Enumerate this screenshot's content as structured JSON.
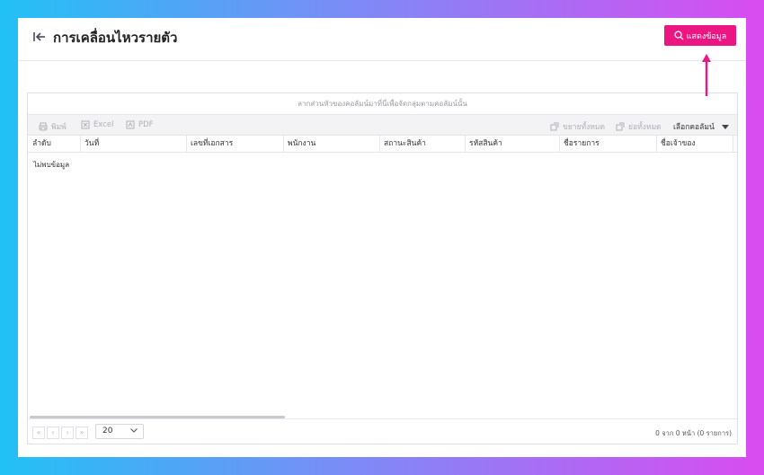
{
  "header": {
    "title": "การเคลื่อนไหวรายตัว",
    "show_button_label": "แสดงข้อมูล"
  },
  "grid": {
    "group_panel_text": "ลากส่วนหัวของคอลัมน์มาที่นี่เพื่อจัดกลุ่มตามคอลัมน์นั้น",
    "toolbar": {
      "print_label": "พิมพ์",
      "excel_label": "Excel",
      "pdf_label": "PDF",
      "expand_all_label": "ขยายทั้งหมด",
      "collapse_all_label": "ย่อทั้งหมด",
      "column_chooser_label": "เลือกคอลัมน์"
    },
    "columns": [
      "ลำดับ",
      "วันที่",
      "เลขที่เอกสาร",
      "พนักงาน",
      "สถานะสินค้า",
      "รหัสสินค้า",
      "ชื่อรายการ",
      "ชื่อเจ้าของ"
    ],
    "empty_text": "ไม่พบข้อมูล",
    "pager": {
      "page_size": "20",
      "info": "0 จาก 0 หน้า (0 รายการ)",
      "first_label": "«",
      "prev_label": "‹",
      "next_label": "›",
      "last_label": "»"
    }
  },
  "colors": {
    "accent": "#ec1682",
    "background_start": "#22c1f5",
    "background_end": "#d94cf0"
  }
}
